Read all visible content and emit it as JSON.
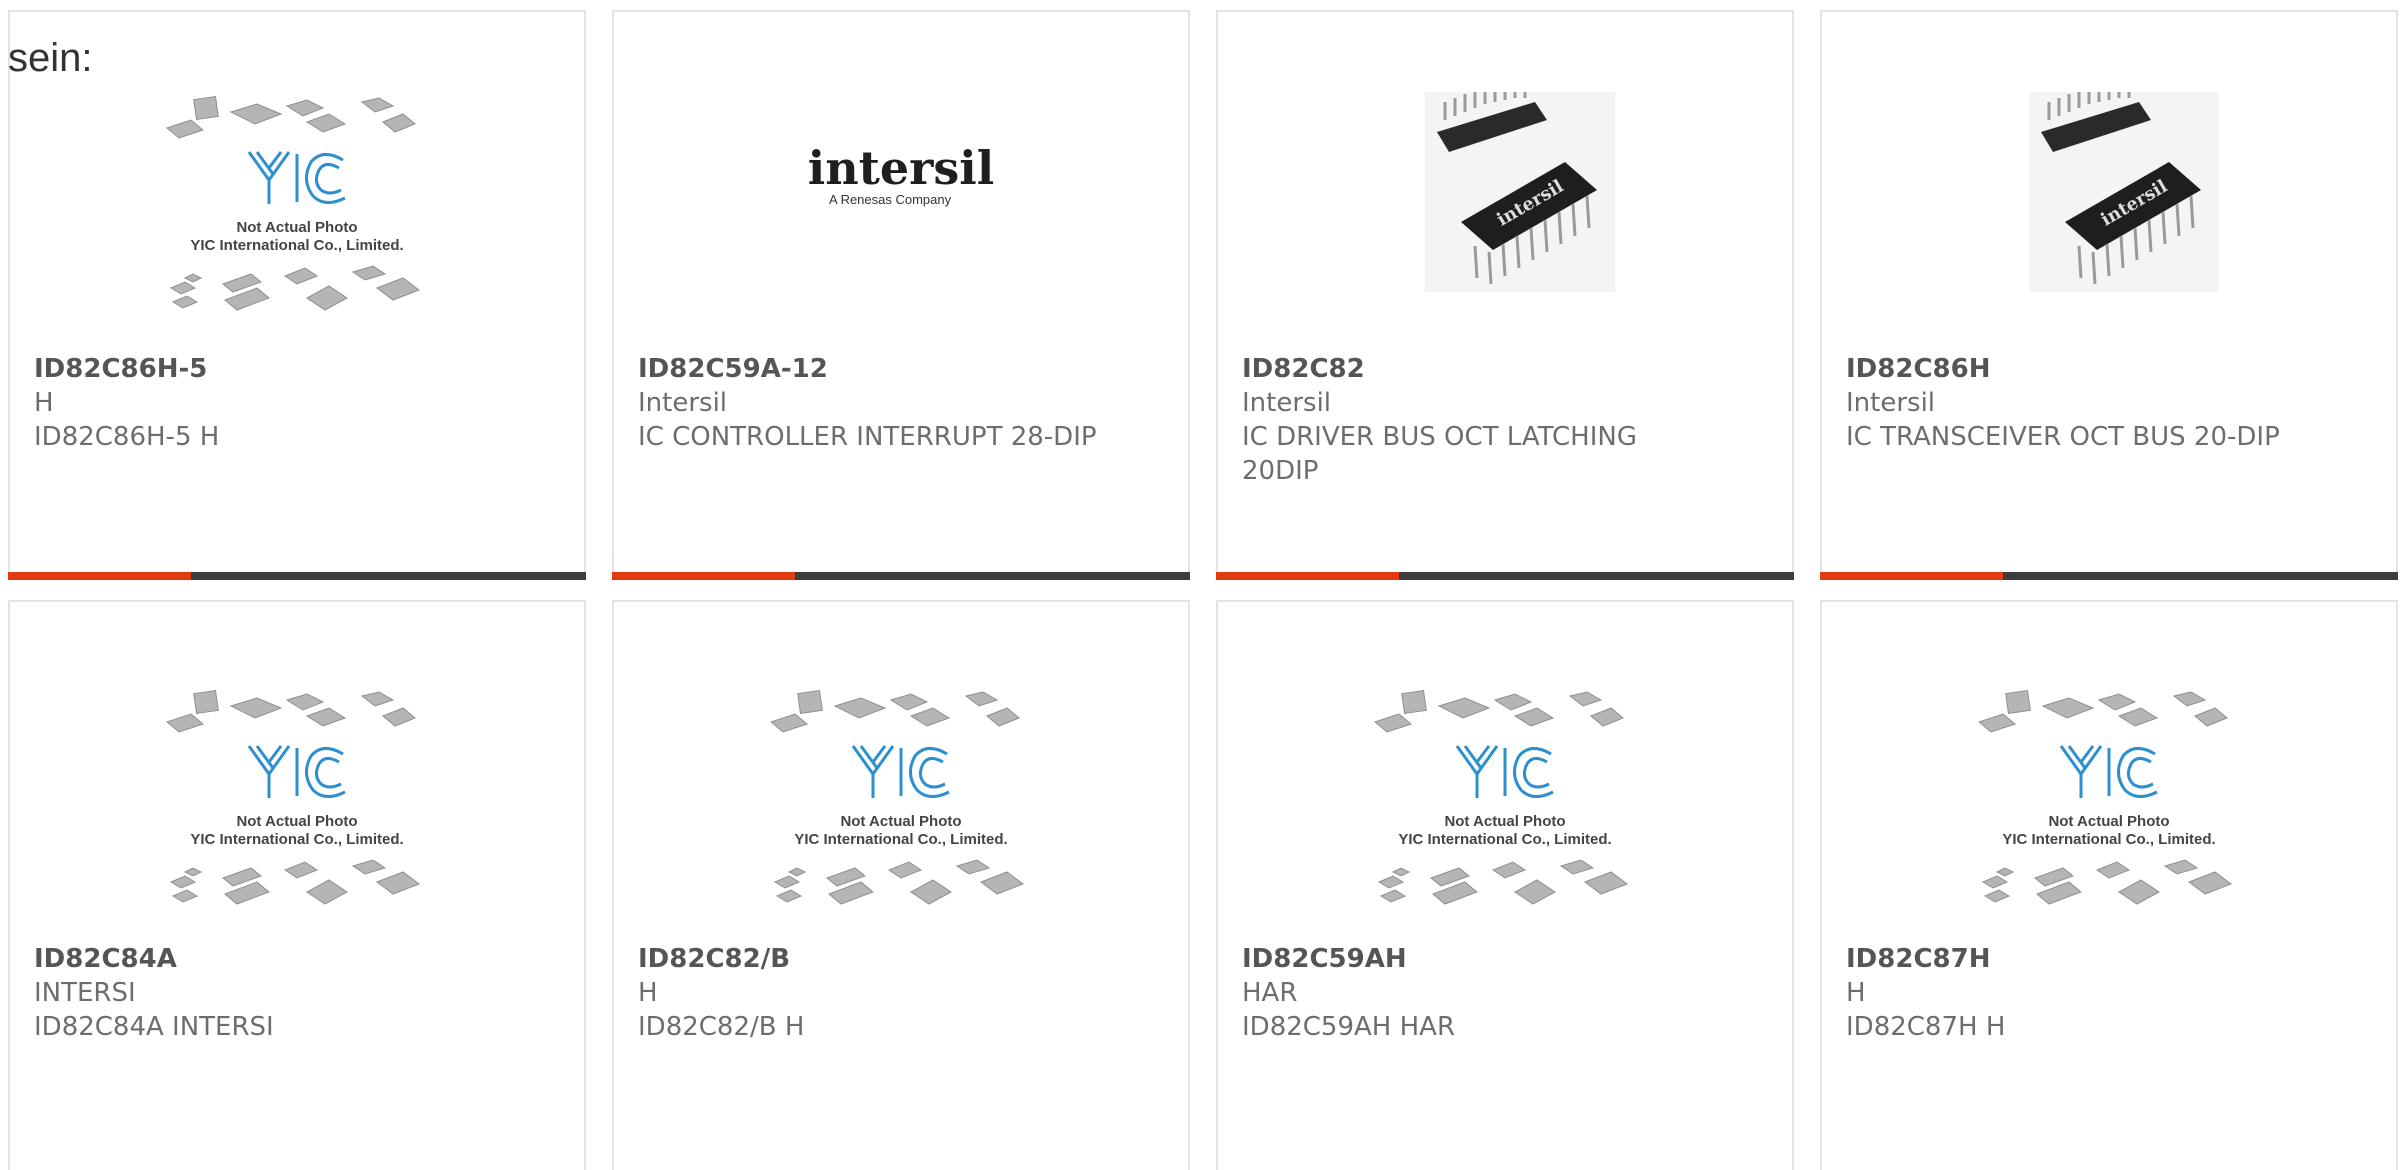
{
  "page": {
    "heading": "sein:"
  },
  "theme": {
    "accent": "#e13a12",
    "bar": "#3d3d3d",
    "text": "#6d6d6d",
    "yic_blue": "#2c8fcf",
    "chip_gray": "#a9a9a9"
  },
  "placeholder_image": {
    "line1": "Not Actual Photo",
    "line2": "YIC International Co., Limited."
  },
  "intersil_logo": {
    "wordmark": "intersil",
    "tagline": "A Renesas Company"
  },
  "cards": [
    {
      "part_number": "ID82C86H-5",
      "manufacturer": "H",
      "description": "ID82C86H-5 H",
      "image": "yic-placeholder"
    },
    {
      "part_number": "ID82C59A-12",
      "manufacturer": "Intersil",
      "description": "IC CONTROLLER INTERRUPT 28-DIP",
      "image": "intersil-logo"
    },
    {
      "part_number": "ID82C82",
      "manufacturer": "Intersil",
      "description": "IC DRIVER BUS OCT LATCHING 20DIP",
      "image": "dip-chip-photo"
    },
    {
      "part_number": "ID82C86H",
      "manufacturer": "Intersil",
      "description": "IC TRANSCEIVER OCT BUS 20-DIP",
      "image": "dip-chip-photo"
    },
    {
      "part_number": "ID82C84A",
      "manufacturer": "INTERSI",
      "description": "ID82C84A INTERSI",
      "image": "yic-placeholder"
    },
    {
      "part_number": "ID82C82/B",
      "manufacturer": "H",
      "description": "ID82C82/B H",
      "image": "yic-placeholder"
    },
    {
      "part_number": "ID82C59AH",
      "manufacturer": "HAR",
      "description": "ID82C59AH HAR",
      "image": "yic-placeholder"
    },
    {
      "part_number": "ID82C87H",
      "manufacturer": "H",
      "description": "ID82C87H H",
      "image": "yic-placeholder"
    }
  ]
}
